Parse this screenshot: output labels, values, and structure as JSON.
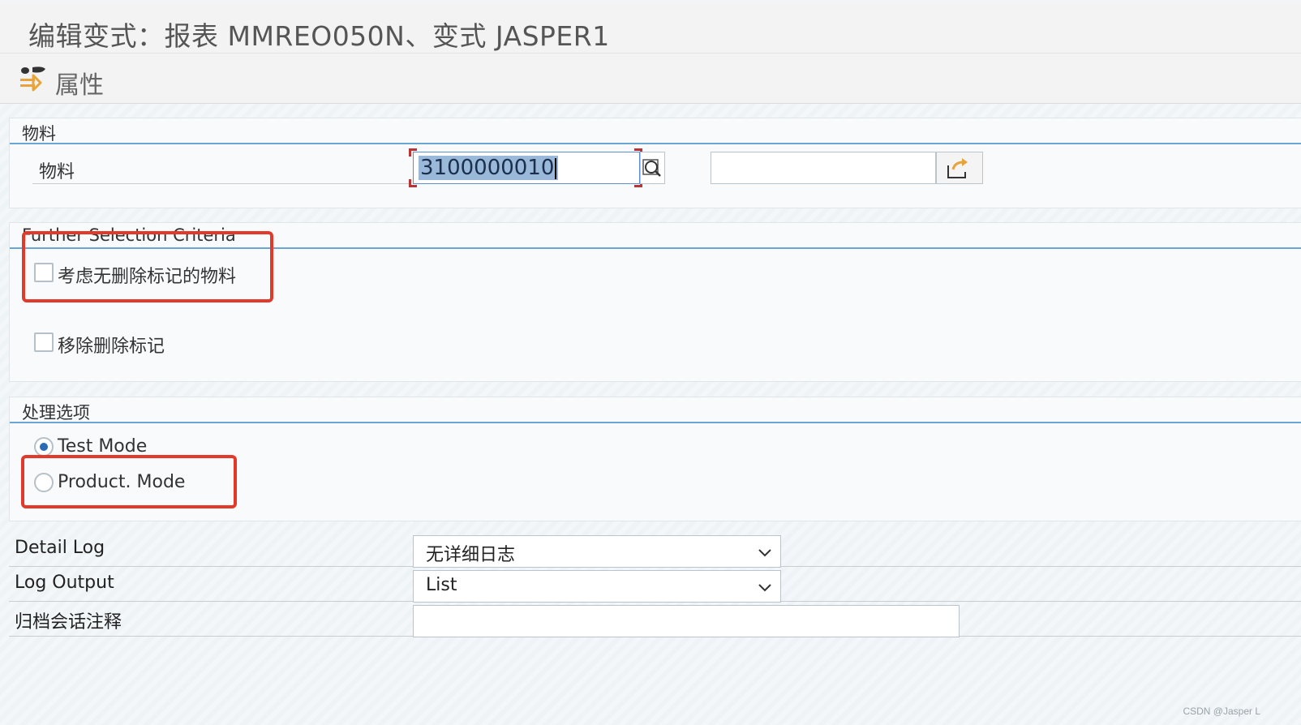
{
  "window": {
    "title": "编辑变式：报表 MMREO050N、变式 JASPER1"
  },
  "toolbar": {
    "attributes_label": "属性",
    "attributes_icon": "attributes-icon"
  },
  "material_group": {
    "title": "物料",
    "field_label": "物料",
    "from_value": "3100000010",
    "to_value": "",
    "search_icon": "search-icon",
    "multiple_selection_icon": "multiple-selection-arrow-icon"
  },
  "further_group": {
    "title": "Further Selection Criteria",
    "options": [
      {
        "label": "考虑无删除标记的物料",
        "checked": false
      },
      {
        "label": "移除删除标记",
        "checked": false
      }
    ]
  },
  "processing_group": {
    "title": "处理选项",
    "modes": [
      {
        "label": "Test Mode",
        "selected": true
      },
      {
        "label": "Product. Mode",
        "selected": false
      }
    ]
  },
  "log_settings": {
    "detail_log_label": "Detail Log",
    "detail_log_value": "无详细日志",
    "log_output_label": "Log Output",
    "log_output_value": "List",
    "archive_note_label": "归档会话注释",
    "archive_note_value": ""
  },
  "watermark": "CSDN @Jasper L",
  "colors": {
    "accent_blue": "#6aa5d3",
    "highlight_red": "#e2392b",
    "selection_bg": "#9ab8da"
  }
}
